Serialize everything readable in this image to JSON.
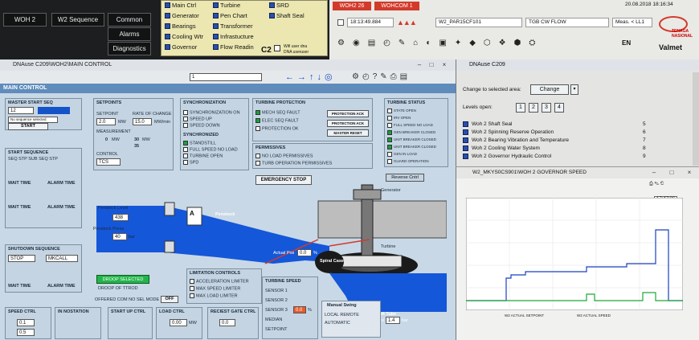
{
  "topbar": {
    "nav_buttons": [
      "WOH 2",
      "W2 Sequence",
      "Common",
      "Alarms",
      "Diagnostics"
    ],
    "menu_items_col1": [
      "Main Ctrl",
      "Generator",
      "Bearings",
      "Cooling Wtr",
      "Governor"
    ],
    "menu_items_col2": [
      "Turbine",
      "Pen Chart",
      "Transformer",
      "Infrastucture",
      "Flow Readin"
    ],
    "menu_items_col3": [
      "SRD",
      "Shaft Seal"
    ],
    "c2_label": "C2",
    "c2_sub1": "Wifi user dna",
    "c2_sub2": "DNA useruser",
    "alarm_tab1": "WOH2 26",
    "alarm_tab2": "WOHCOM 1",
    "alarm_time": "18:13:49.884",
    "alarm_tag": "W2_PAR15CF101",
    "alarm_text": "TGB CW FLOW",
    "alarm_meas": "Meas. < LL1",
    "date_time": "20.08.2018  18:16:34",
    "lang": "EN",
    "brand1": "TENAGA NASIONAL",
    "brand2": "Valmet"
  },
  "main": {
    "title": "DNAuse C209\\WOH2\\MAIN CONTROL",
    "section": "MAIN CONTROL",
    "page_field": "1",
    "master_start_seq": "MASTER START SEQ",
    "master_val": "12",
    "master_status": "No sequence selected",
    "start_btn": "START",
    "start_sequence": "START SEQUENCE",
    "start_steps": "SEQ STP SUB SEQ STP",
    "wait_time": "WAIT TIME",
    "alarm_time_lbl": "ALARM TIME",
    "shutdown_seq": "SHUTDOWN SEQUENCE",
    "shutdown_stop": "STOP",
    "shutdown_mode": "MKCALL",
    "setpoints": "SETPOINTS",
    "setpoint_lbl": "SETPOINT",
    "setpoint_val": "2.0",
    "setpoint_unit": "MW",
    "rate_of_change": "RATE OF CHANGE",
    "rate_val": "15.0",
    "rate_unit": "MW/min",
    "measurement": "MEASUREMENT",
    "meas_mw": "0",
    "meas_mw_unit": "MW",
    "meas_30": "30",
    "meas_30_unit": "MW",
    "meas_35": "35",
    "control": "CONTROL",
    "control_val": "TCS",
    "sync": "SYNCHRONIZATION",
    "sync_items": [
      "SYNCHRONIZATION ON",
      "SPEED UP",
      "SPEED DOWN"
    ],
    "synchronized": "SYNCHRONIZED",
    "sync_state_items": [
      "STANDSTILL",
      "FULL SPEED NO LOAD",
      "TURBINE OPEN",
      "SPD"
    ],
    "turbine_protection": "TURBINE PROTECTION",
    "tp_items": [
      "MECH SEQ FAULT",
      "ELEC SEQ FAULT",
      "PROTECTION OK"
    ],
    "tp_btns": [
      "PROTECTION ACK",
      "PROTECTION ACK",
      "MASTER RESET"
    ],
    "permissives": "PERMISSIVES",
    "perm_items": [
      "NO LOAD PERMISSIVES",
      "TURB OPERATION PERMISSIVES"
    ],
    "emergency_stop": "EMERGENCY STOP",
    "turbine_status": "TURBINE STATUS",
    "ts_items": [
      "STATE OPEN",
      "IRV OPEN",
      "FULL SPEED NO LOAD",
      "GEN BREAKER CLOSED",
      "UNIT BREAKER CLOSED",
      "UNIT BREAKER CLOSED",
      "GEN IN LOAD",
      "GUARD OPERATION"
    ],
    "gen_label": "Generator",
    "turbine_label": "Turbine",
    "penstock_label": "Penstock",
    "spiral_case": "Spiral Case",
    "draft_tube": "Draft Tube",
    "pressure_lbl": "Pressure",
    "pressure_val": "1.4",
    "pressure_unit": "bar",
    "actual_pos_lbl": "Actual Pos",
    "actual_pos_val": "0.0",
    "actual_pos_unit": "%",
    "penstock_level": "Penstock Level",
    "penstock_level_val": "438",
    "penstock_press": "Penstock Press",
    "penstock_press_val": "40",
    "penstock_press_unit": "bar",
    "intake_label": "A",
    "droop_btn": "DROOP SELECTED",
    "droop_btn2": "DROOP OF TTROD",
    "offered": "OFFERED COM NO SEL MODE",
    "off_btn": "OFF",
    "limitation": "LIMITATION CONTROLS",
    "lim_items": [
      "ACCELERATION LIMITER",
      "MAX SPEED LIMITER",
      "MAX LOAD LIMITER"
    ],
    "turbine_speed": "TURBINE SPEED",
    "ts_rows": [
      "SENSOR 1",
      "SENSOR 2",
      "SENSOR 3",
      "MEDIAN",
      "SETPOINT"
    ],
    "sensor3_val": "0.0",
    "sensor_unit": "%",
    "bottom_boxes": [
      "SPEED CTRL",
      "IN NOSTATION",
      "START UP CTRL",
      "LOAD CTRL",
      "RECIEST GATE CTRL"
    ],
    "sc_pct1": "0.1",
    "sc_pct2": "0.5",
    "load_mw": "0.00",
    "load_mw_unit": "MW",
    "recgate_pct": "0.0",
    "manual_swap": "Manual Swing",
    "control_btn": "Reverse Cntrl",
    "maint_text1": "LOCAL REMOTE",
    "maint_text2": "AUTOMATIC"
  },
  "dna": {
    "title": "DNAuse C209",
    "change_lbl": "Change to selected area:",
    "change_btn": "Change",
    "levels_lbl": "Levels open:",
    "levels": [
      "1",
      "2",
      "3",
      "4"
    ],
    "rows": [
      {
        "label": "Woh 2 Shaft Seal",
        "num": "5"
      },
      {
        "label": "Woh 2 Spinning Reserve Operation",
        "num": "6"
      },
      {
        "label": "Woh 2 Bearing Vibration and Temperature",
        "num": "7"
      },
      {
        "label": "Woh 2 Cooling Water System",
        "num": "8"
      },
      {
        "label": "Woh 2 Governor Hydraulic Control",
        "num": "9"
      }
    ]
  },
  "graph": {
    "title": "W2_MKYS0CS901\\WOH 2 GOVERNOR SPEED",
    "top_time": "17:47:36",
    "legend1": "W2 ACTUAL SETPOINT",
    "legend2": "W2 ACTUAL SPEED"
  }
}
